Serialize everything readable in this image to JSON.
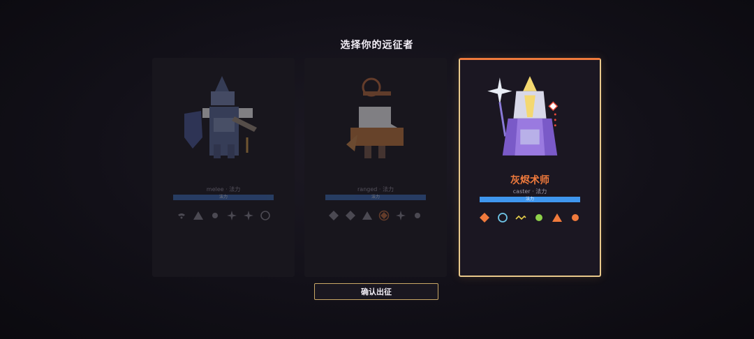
{
  "header": {
    "title": "选择你的远征者"
  },
  "cards": [
    {
      "name": "",
      "subtitle": "melee · 法力",
      "bar_label": "法力",
      "selected": false,
      "icons": [
        "wifi-icon",
        "triangle-icon",
        "dot-icon",
        "sparkle-icon",
        "sparkle-icon",
        "circle-icon"
      ]
    },
    {
      "name": "",
      "subtitle": "ranged · 法力",
      "bar_label": "法力",
      "selected": false,
      "icons": [
        "diamond-icon",
        "diamond-icon",
        "triangle-icon",
        "target-icon",
        "sparkle-icon",
        "dot-icon"
      ]
    },
    {
      "name": "灰烬术师",
      "subtitle": "caster · 法力",
      "bar_label": "法力",
      "selected": true,
      "icons": [
        "diamond-icon",
        "circle-icon",
        "wave-icon",
        "dot-icon",
        "triangle-icon",
        "dot-icon"
      ]
    }
  ],
  "confirm_button": {
    "label": "确认出征"
  },
  "colors": {
    "accent_orange": "#f07a3c",
    "gold_border": "#e9c98b",
    "mana_blue": "#3f96ee",
    "icon_cyan": "#6fc6e8",
    "icon_yellow": "#e8d04a",
    "icon_green": "#8ed04a",
    "icon_gray": "#8a8894"
  }
}
